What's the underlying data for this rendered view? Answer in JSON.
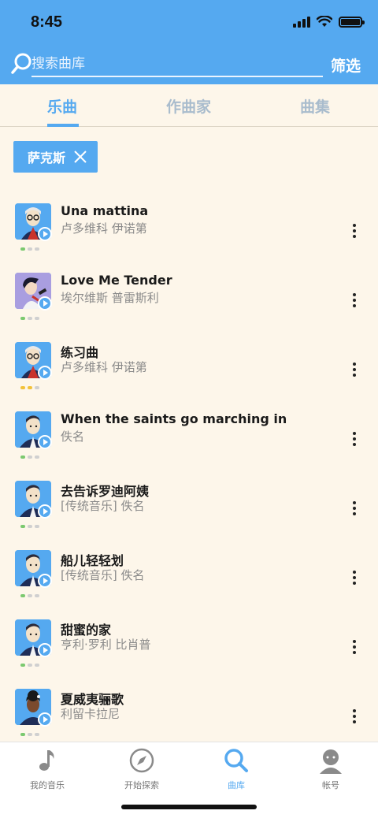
{
  "status": {
    "time": "8:45"
  },
  "search": {
    "placeholder": "搜索曲库",
    "filter_label": "筛选"
  },
  "tabs": [
    {
      "label": "乐曲",
      "active": true
    },
    {
      "label": "作曲家",
      "active": false
    },
    {
      "label": "曲集",
      "active": false
    }
  ],
  "filter_chip": {
    "label": "萨克斯"
  },
  "songs": [
    {
      "title": "Una mattina",
      "subtitle": "卢多维科 伊诺第",
      "avatar": "old-man-glasses",
      "difficulty": 1,
      "difficulty_color": "#7bc96f"
    },
    {
      "title": "Love Me Tender",
      "subtitle": "埃尔维斯 普雷斯利",
      "avatar": "singer-elvis",
      "difficulty": 1,
      "difficulty_color": "#7bc96f"
    },
    {
      "title": "练习曲",
      "subtitle": "卢多维科 伊诺第",
      "avatar": "old-man-glasses",
      "difficulty": 2,
      "difficulty_color": "#f2c23b"
    },
    {
      "title": "When the saints go marching in",
      "subtitle": "佚名",
      "avatar": "generic-man",
      "difficulty": 1,
      "difficulty_color": "#7bc96f"
    },
    {
      "title": "去告诉罗迪阿姨",
      "subtitle": "[传统音乐] 佚名",
      "avatar": "generic-man",
      "difficulty": 1,
      "difficulty_color": "#7bc96f"
    },
    {
      "title": "船儿轻轻划",
      "subtitle": "[传统音乐] 佚名",
      "avatar": "generic-man",
      "difficulty": 1,
      "difficulty_color": "#7bc96f"
    },
    {
      "title": "甜蜜的家",
      "subtitle": "亨利·罗利 比肖普",
      "avatar": "generic-man",
      "difficulty": 1,
      "difficulty_color": "#7bc96f"
    },
    {
      "title": "夏威夷骊歌",
      "subtitle": "利留卡拉尼",
      "avatar": "woman",
      "difficulty": 1,
      "difficulty_color": "#7bc96f"
    }
  ],
  "tabbar": [
    {
      "label": "我的音乐",
      "icon": "music-note-icon",
      "active": false
    },
    {
      "label": "开始探索",
      "icon": "compass-icon",
      "active": false
    },
    {
      "label": "曲库",
      "icon": "search-icon",
      "active": true
    },
    {
      "label": "帐号",
      "icon": "user-icon",
      "active": false
    }
  ],
  "colors": {
    "accent": "#55a9f0",
    "background": "#fdf6ea"
  }
}
